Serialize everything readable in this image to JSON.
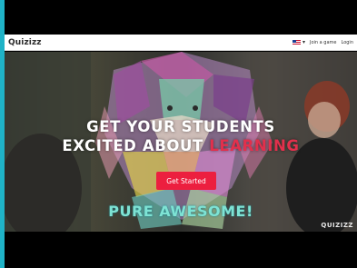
{
  "navbar": {
    "logo": "Quizizz",
    "join_label": "Join a game",
    "login_label": "Login",
    "language_icon": "us-flag-icon"
  },
  "hero": {
    "headline_line1": "GET YOUR STUDENTS",
    "headline_line2_start": "EXCITED ABOUT",
    "headline_line2_accent": "LEARNING",
    "cta_label": "Get Started",
    "slogan": "PURE AWESOME!",
    "watermark": "QUIZIZZ"
  },
  "colors": {
    "accent_red": "#ec1f3f",
    "slogan_teal": "#7ee3d4",
    "frame_cyan": "#1fb3c7"
  }
}
